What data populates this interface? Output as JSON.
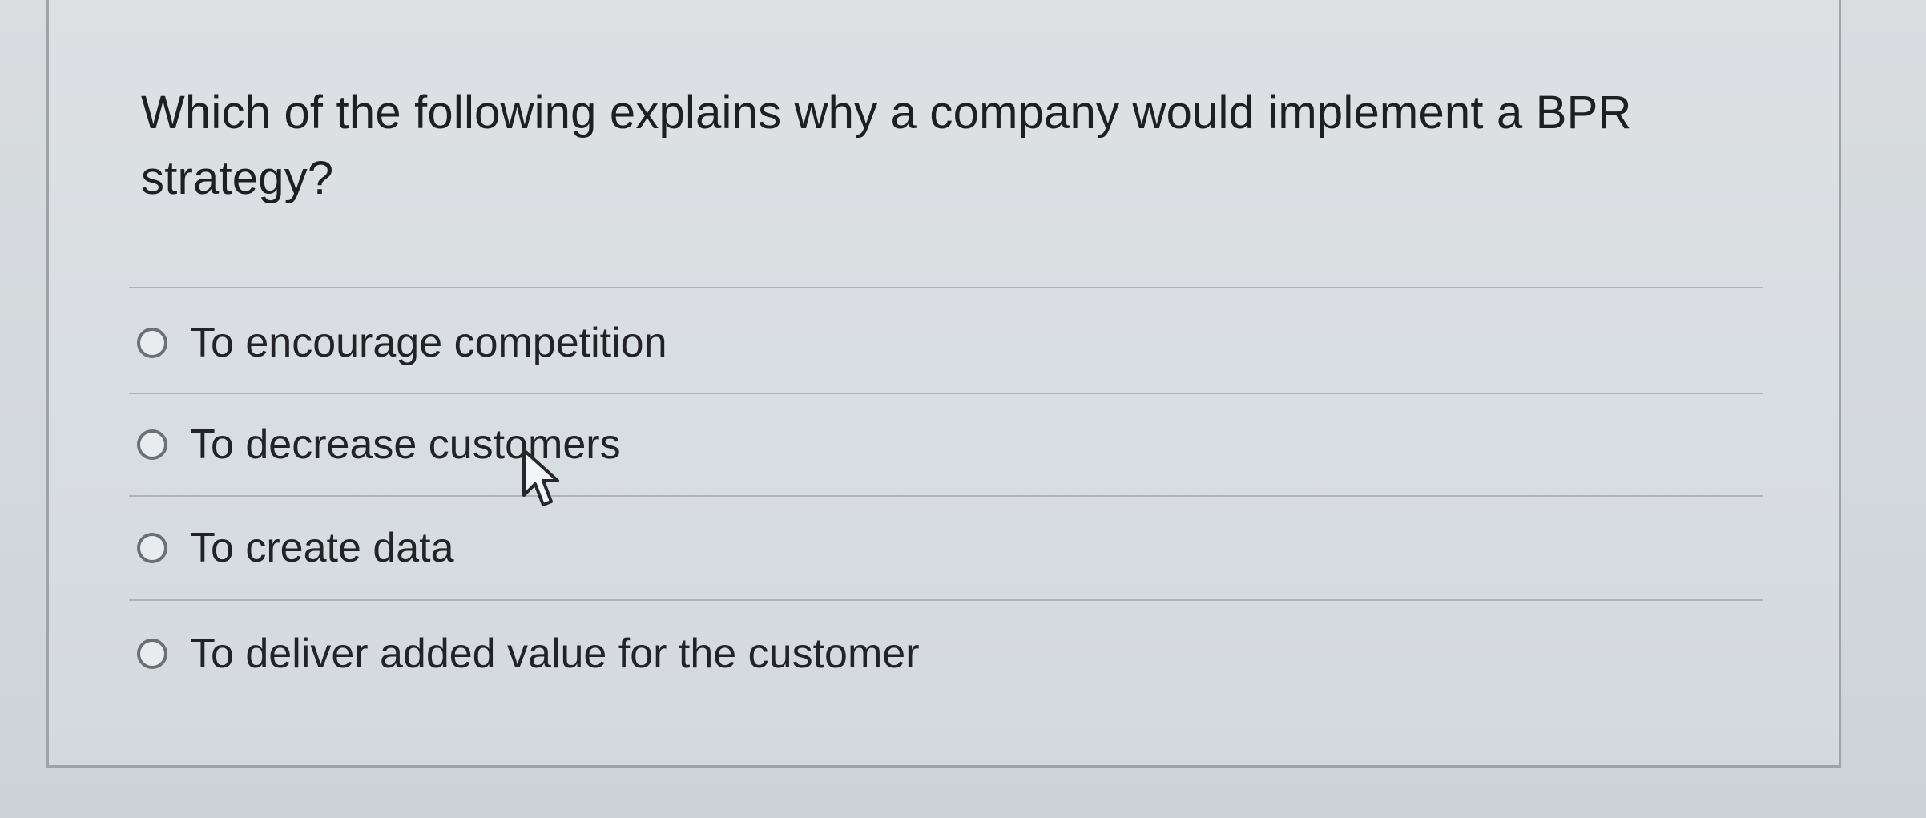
{
  "question": {
    "text": "Which of the following explains why a company would implement a BPR strategy?"
  },
  "answers": [
    {
      "label": "To encourage competition",
      "selected": false
    },
    {
      "label": "To decrease customers",
      "selected": false
    },
    {
      "label": "To create data",
      "selected": false
    },
    {
      "label": "To deliver added value for the customer",
      "selected": false
    }
  ],
  "icons": {
    "radio": "radio-button-icon",
    "pointer": "mouse-pointer-icon"
  },
  "colors": {
    "background": "#d6dbdf",
    "text": "#1e1f21",
    "radio_border": "#6b7075",
    "divider": "#aeb4b8"
  }
}
